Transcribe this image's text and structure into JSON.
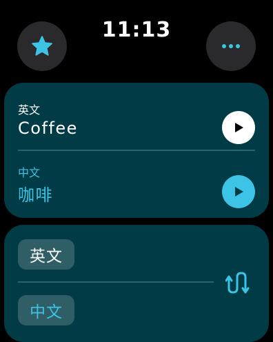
{
  "status": {
    "time": "11:13"
  },
  "toolbar": {
    "favorite_icon": "star-icon",
    "more_icon": "ellipsis-icon"
  },
  "translation": {
    "source": {
      "language": "英文",
      "text": "Coffee"
    },
    "target": {
      "language": "中文",
      "text": "咖啡"
    }
  },
  "language_selector": {
    "source_language": "英文",
    "target_language": "中文",
    "swap_icon": "swap-arrows-icon"
  },
  "colors": {
    "background": "#000000",
    "card": "#013c46",
    "accent": "#3cc3e6",
    "button_dark": "#2a2a2c",
    "chip": "#2f5e66"
  }
}
